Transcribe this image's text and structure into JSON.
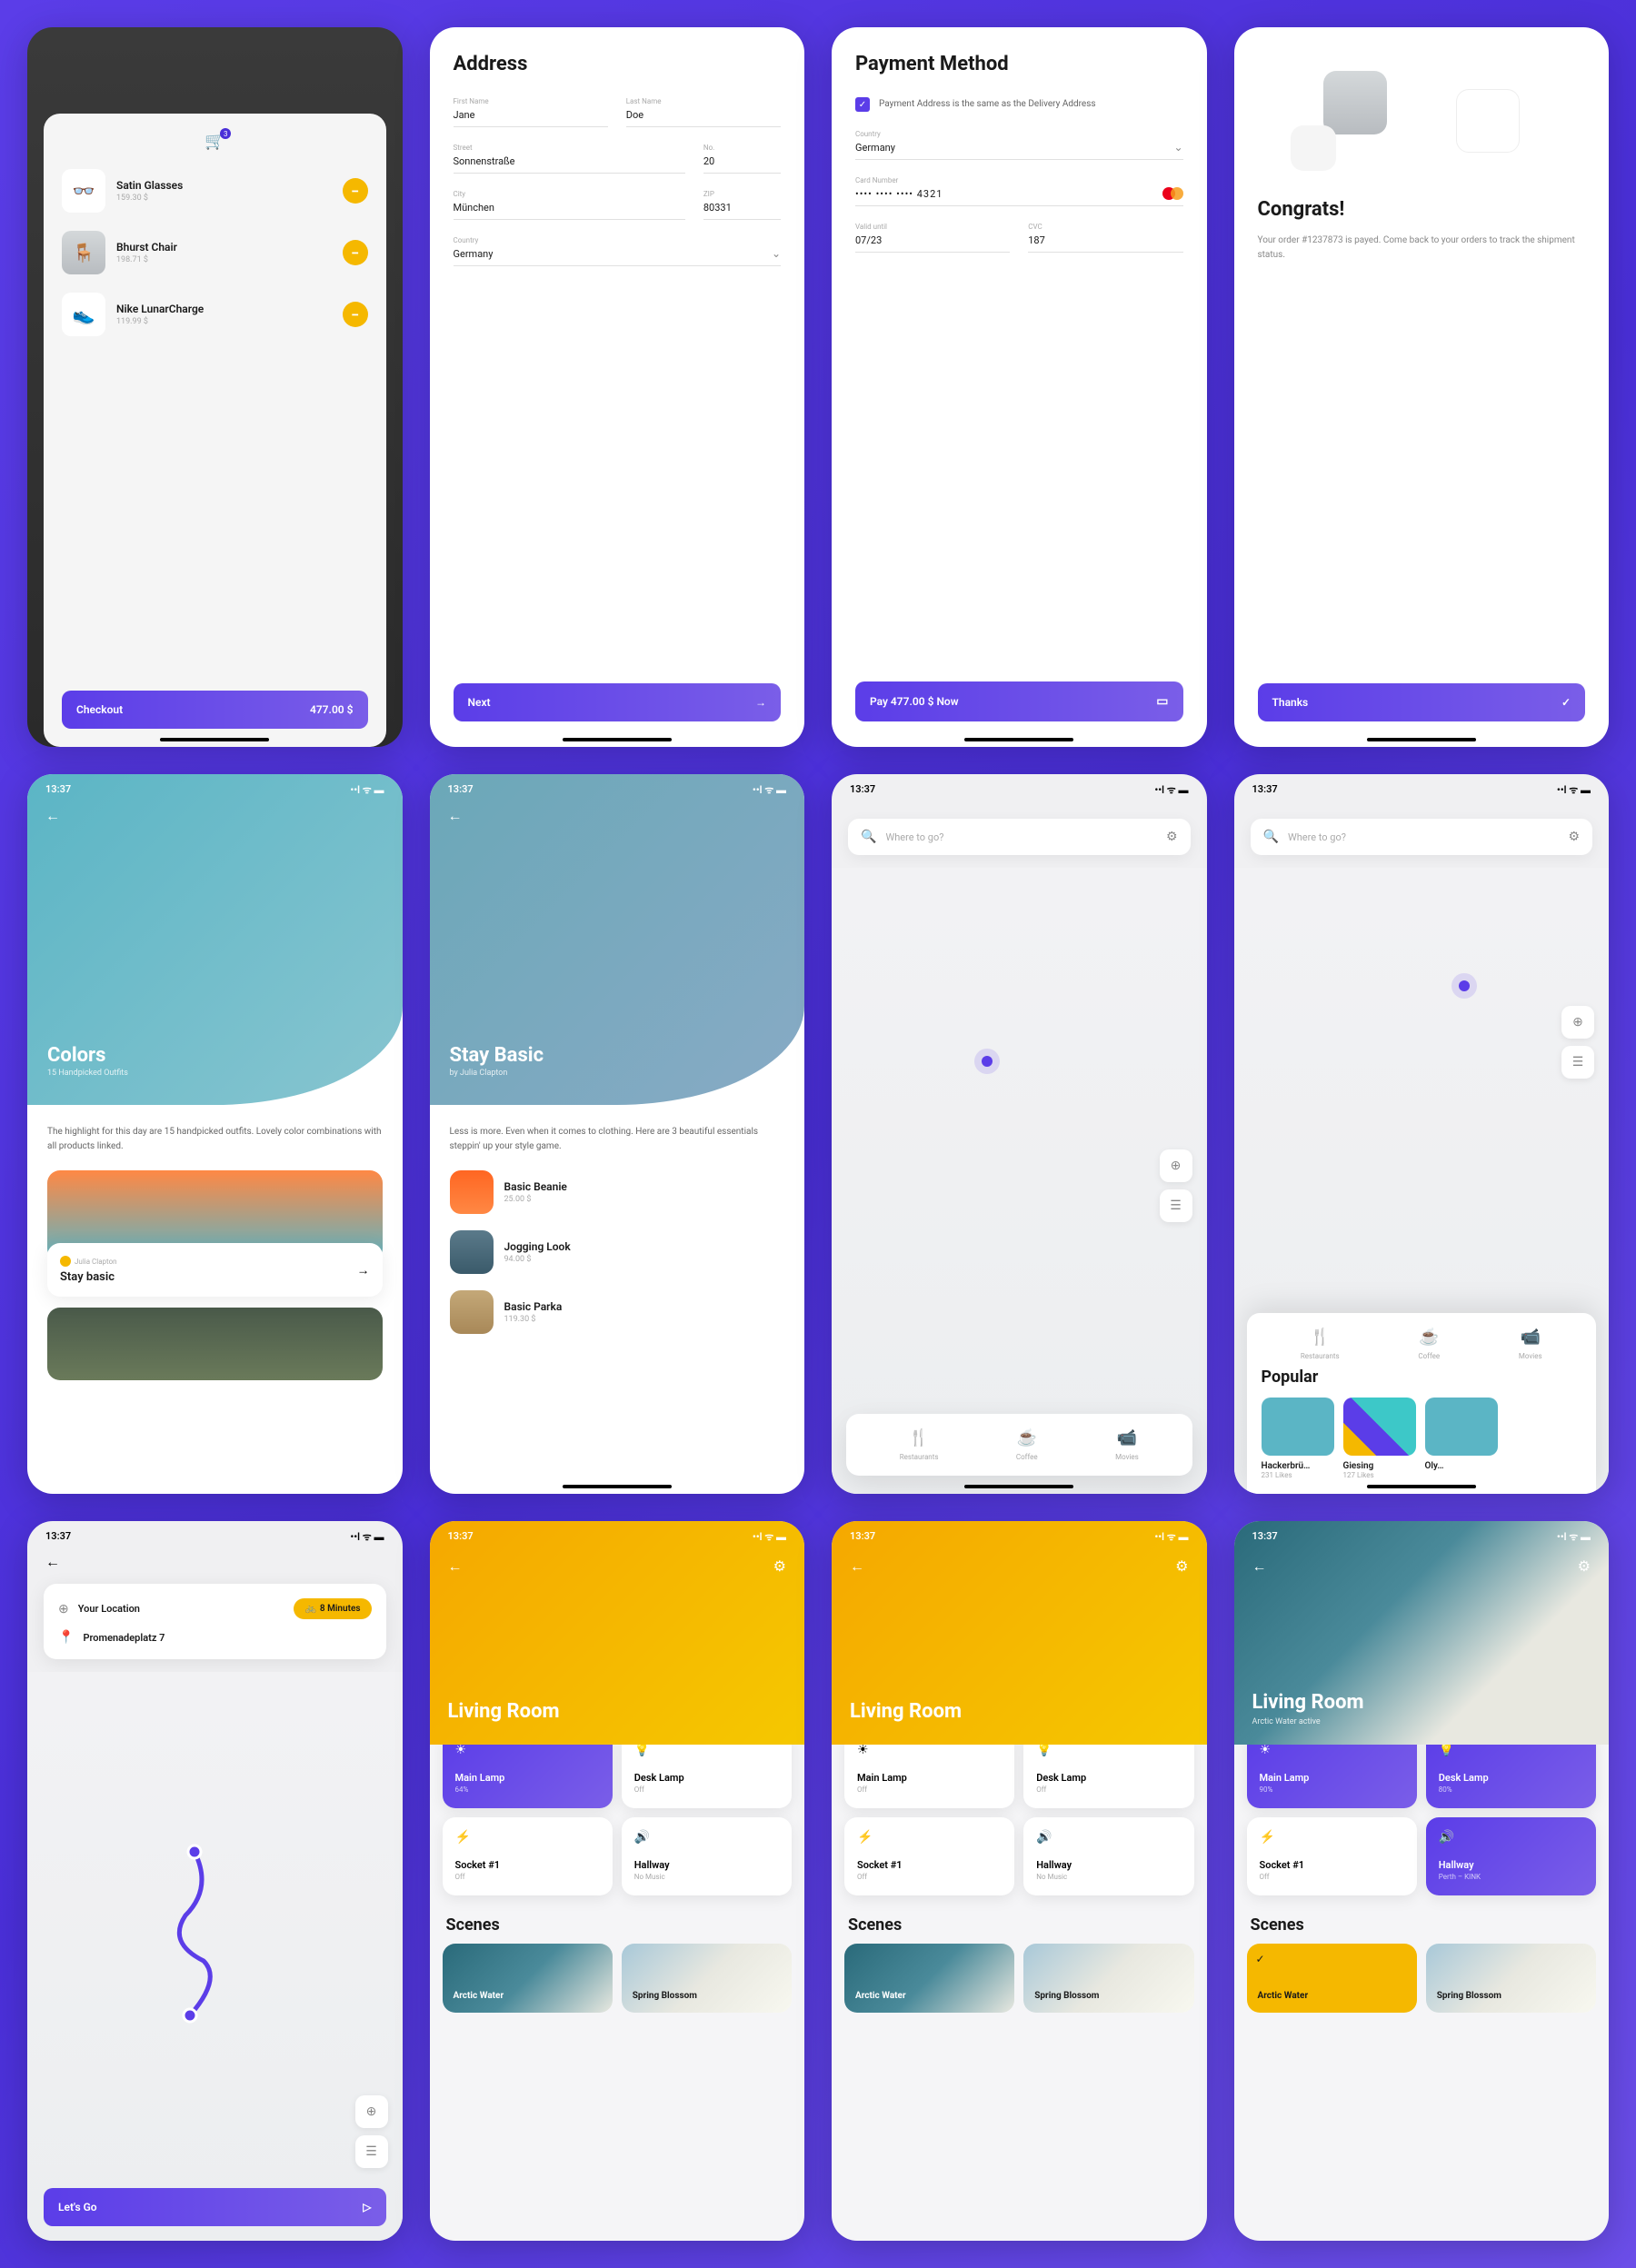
{
  "status_time": "13:37",
  "row1": {
    "cart": {
      "items": [
        {
          "name": "Satin Glasses",
          "price": "159.30 $"
        },
        {
          "name": "Bhurst Chair",
          "price": "198.71 $"
        },
        {
          "name": "Nike LunarCharge",
          "price": "119.99 $"
        }
      ],
      "checkout_label": "Checkout",
      "total": "477.00 $"
    },
    "address": {
      "title": "Address",
      "first_name_label": "First Name",
      "first_name": "Jane",
      "last_name_label": "Last Name",
      "last_name": "Doe",
      "street_label": "Street",
      "street": "Sonnenstraße",
      "no_label": "No.",
      "no": "20",
      "city_label": "City",
      "city": "München",
      "zip_label": "ZIP",
      "zip": "80331",
      "country_label": "Country",
      "country": "Germany",
      "next_label": "Next"
    },
    "payment": {
      "title": "Payment Method",
      "same_address": "Payment Address is the same as the Delivery Address",
      "country_label": "Country",
      "country": "Germany",
      "card_label": "Card Number",
      "card": "•••• •••• •••• 4321",
      "valid_label": "Valid until",
      "valid": "07/23",
      "cvc_label": "CVC",
      "cvc": "187",
      "pay_label": "Pay 477.00 $ Now"
    },
    "congrats": {
      "title": "Congrats!",
      "text": "Your order #1237873 is payed. Come back to your orders to track the shipment status.",
      "thanks_label": "Thanks"
    }
  },
  "row2": {
    "colors": {
      "title": "Colors",
      "sub": "15 Handpicked Outfits",
      "text": "The highlight for this day are 15 handpicked outfits. Lovely color combinations with all products linked.",
      "card_author": "Julia Clapton",
      "card_title": "Stay basic"
    },
    "basic": {
      "title": "Stay Basic",
      "sub": "by Julia Clapton",
      "text": "Less is more. Even when it comes to clothing. Here are 3 beautiful essentials steppin' up your style game.",
      "products": [
        {
          "name": "Basic Beanie",
          "price": "25.00 $"
        },
        {
          "name": "Jogging Look",
          "price": "94.00 $"
        },
        {
          "name": "Basic Parka",
          "price": "119.30 $"
        }
      ]
    },
    "map": {
      "search_placeholder": "Where to go?",
      "categories": [
        {
          "name": "Restaurants"
        },
        {
          "name": "Coffee"
        },
        {
          "name": "Movies"
        }
      ],
      "popular_title": "Popular",
      "popular": [
        {
          "name": "Hackerbrü…",
          "likes": "231 Likes"
        },
        {
          "name": "Giesing",
          "likes": "127 Likes"
        },
        {
          "name": "Oly…",
          "likes": ""
        }
      ]
    }
  },
  "row3": {
    "route": {
      "your_location": "Your Location",
      "minutes": "8 Minutes",
      "destination": "Promenadeplatz 7",
      "lets_go": "Let's Go"
    },
    "living_a": {
      "title": "Living Room",
      "devices": [
        {
          "name": "Main Lamp",
          "sub": "64%",
          "on": true
        },
        {
          "name": "Desk Lamp",
          "sub": "Off",
          "on": false
        },
        {
          "name": "Socket #1",
          "sub": "Off",
          "on": false
        },
        {
          "name": "Hallway",
          "sub": "No Music",
          "on": false
        }
      ],
      "scenes_title": "Scenes",
      "scenes": [
        {
          "name": "Arctic Water"
        },
        {
          "name": "Spring Blossom"
        }
      ]
    },
    "living_b": {
      "title": "Living Room",
      "devices": [
        {
          "name": "Main Lamp",
          "sub": "Off",
          "on": false
        },
        {
          "name": "Desk Lamp",
          "sub": "Off",
          "on": false
        },
        {
          "name": "Socket #1",
          "sub": "Off",
          "on": false
        },
        {
          "name": "Hallway",
          "sub": "No Music",
          "on": false
        }
      ],
      "scenes_title": "Scenes",
      "scenes": [
        {
          "name": "Arctic Water"
        },
        {
          "name": "Spring Blossom"
        }
      ]
    },
    "living_c": {
      "title": "Living Room",
      "sub": "Arctic Water active",
      "devices": [
        {
          "name": "Main Lamp",
          "sub": "90%",
          "on": true
        },
        {
          "name": "Desk Lamp",
          "sub": "80%",
          "on": true
        },
        {
          "name": "Socket #1",
          "sub": "Off",
          "on": false
        },
        {
          "name": "Hallway",
          "sub": "Perth – KINK",
          "on": true
        }
      ],
      "scenes_title": "Scenes",
      "scenes": [
        {
          "name": "Arctic Water",
          "active": true
        },
        {
          "name": "Spring Blossom"
        }
      ]
    }
  }
}
